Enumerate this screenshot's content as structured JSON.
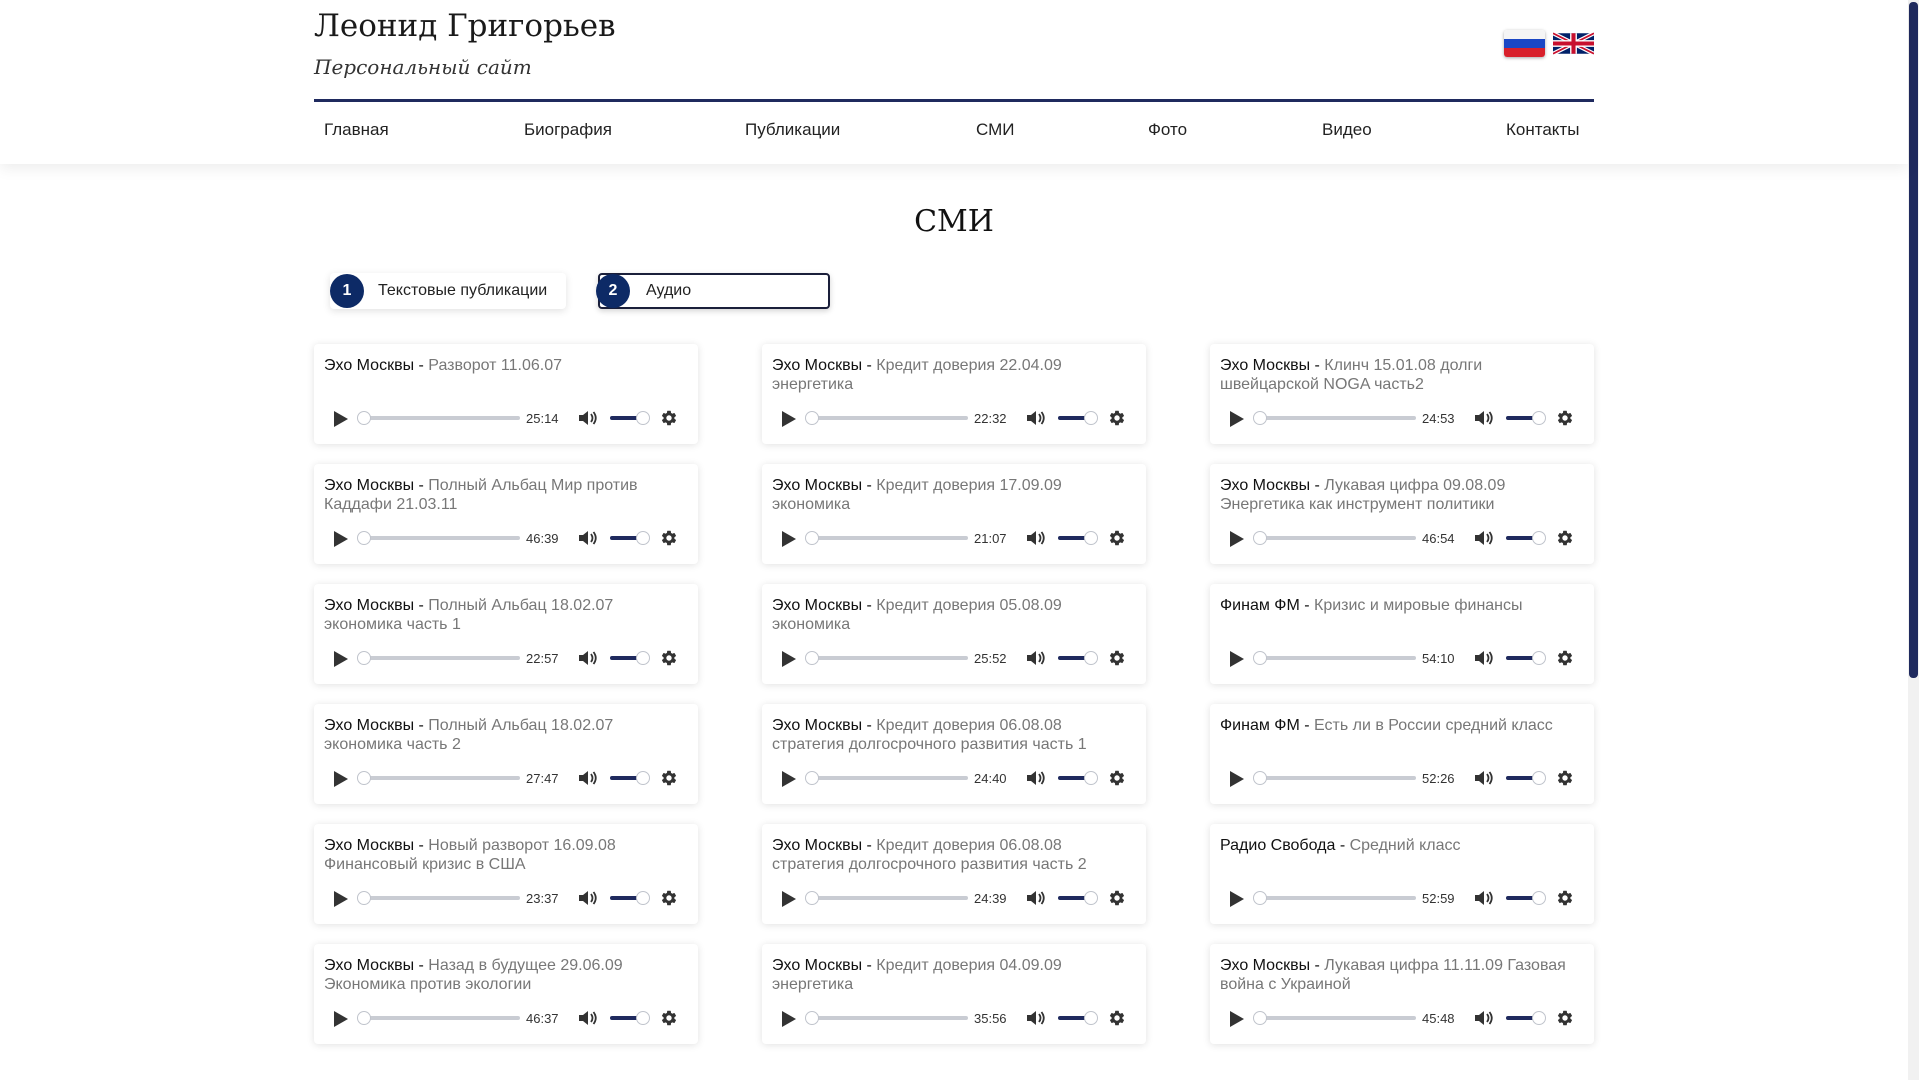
{
  "site": {
    "title": "Леонид Григорьев",
    "subtitle": "Персональный сайт"
  },
  "languages": [
    {
      "name": "ru-flag-icon"
    },
    {
      "name": "uk-flag-icon"
    }
  ],
  "nav": [
    "Главная",
    "Биография",
    "Публикации",
    "СМИ",
    "Фото",
    "Видео",
    "Контакты"
  ],
  "page": {
    "title": "СМИ",
    "tabs": [
      {
        "num": "1",
        "label": "Текстовые публикации",
        "active": false
      },
      {
        "num": "2",
        "label": "Аудио",
        "active": true
      }
    ]
  },
  "colors": {
    "accent": "#1f2a5e",
    "badge": "#0d2a66",
    "text_muted": "#777777"
  },
  "audio": [
    {
      "source": "Эхо Москвы",
      "title": "Разворот 11.06.07",
      "duration": "25:14"
    },
    {
      "source": "Эхо Москвы",
      "title": "Кредит доверия 22.04.09 энергетика",
      "duration": "22:32"
    },
    {
      "source": "Эхо Москвы",
      "title": "Клинч 15.01.08 долги швейцарской NOGA часть2",
      "duration": "24:53"
    },
    {
      "source": "Эхо Москвы",
      "title": "Полный Альбац Мир против Каддафи 21.03.11",
      "duration": "46:39"
    },
    {
      "source": "Эхо Москвы",
      "title": "Кредит доверия 17.09.09 экономика",
      "duration": "21:07"
    },
    {
      "source": "Эхо Москвы",
      "title": "Лукавая цифра 09.08.09 Энергетика как инструмент политики",
      "duration": "46:54"
    },
    {
      "source": "Эхо Москвы",
      "title": "Полный Альбац 18.02.07 экономика часть 1",
      "duration": "22:57"
    },
    {
      "source": "Эхо Москвы",
      "title": "Кредит доверия 05.08.09 экономика",
      "duration": "25:52"
    },
    {
      "source": "Финам ФМ",
      "title": "Кризис и мировые финансы",
      "duration": "54:10"
    },
    {
      "source": "Эхо Москвы",
      "title": "Полный Альбац 18.02.07 экономика часть 2",
      "duration": "27:47"
    },
    {
      "source": "Эхо Москвы",
      "title": "Кредит доверия 06.08.08 стратегия долгосрочного развития часть 1",
      "duration": "24:40"
    },
    {
      "source": "Финам ФМ",
      "title": "Есть ли в России средний класс",
      "duration": "52:26"
    },
    {
      "source": "Эхо Москвы",
      "title": "Новый разворот 16.09.08 Финансовый кризис в США",
      "duration": "23:37"
    },
    {
      "source": "Эхо Москвы",
      "title": "Кредит доверия 06.08.08 стратегия долгосрочного развития часть 2",
      "duration": "24:39"
    },
    {
      "source": "Радио Свобода",
      "title": "Средний класс",
      "duration": "52:59"
    },
    {
      "source": "Эхо Москвы",
      "title": "Назад в будущее 29.06.09 Экономика против экологии",
      "duration": "46:37"
    },
    {
      "source": "Эхо Москвы",
      "title": "Кредит доверия 04.09.09 энергетика",
      "duration": "35:56"
    },
    {
      "source": "Эхо Москвы",
      "title": "Лукавая цифра 11.11.09 Газовая война с Украиной",
      "duration": "45:48"
    }
  ]
}
